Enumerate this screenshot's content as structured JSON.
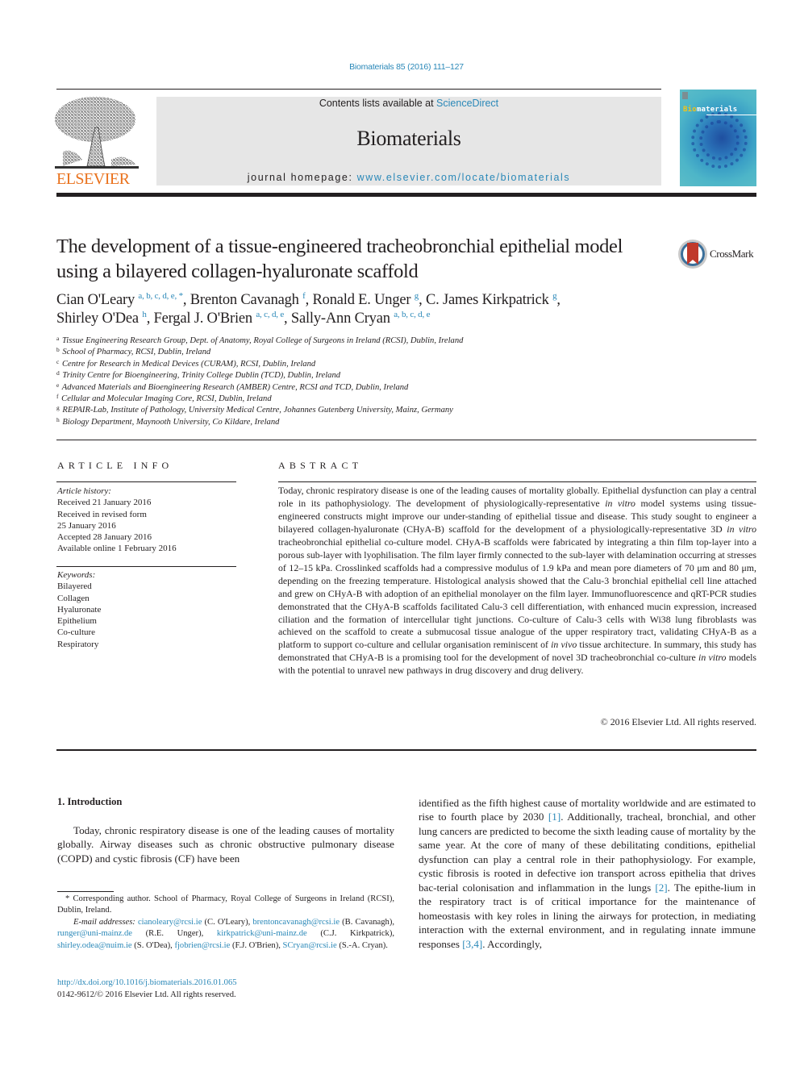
{
  "header": {
    "journal_ref": "Biomaterials 85 (2016) 111–127",
    "contents_prefix": "Contents lists available at ",
    "contents_link": "ScienceDirect",
    "journal_name": "Biomaterials",
    "homepage_prefix": "journal homepage: ",
    "homepage_link": "www.elsevier.com/locate/biomaterials",
    "publisher_logo_text": "ELSEVIER",
    "cover_title_highlight": "Bio",
    "cover_title_rest": "materials",
    "colors": {
      "link": "#2a88b8",
      "elsevier_orange": "#e9711c",
      "banner_gray": "#e6e6e6"
    }
  },
  "article": {
    "title": "The development of a tissue-engineered tracheobronchial epithelial model using a bilayered collagen-hyaluronate scaffold",
    "crossmark_label": "CrossMark",
    "authors": [
      {
        "name": "Cian O'Leary",
        "affil": "a, b, c, d, e, *",
        "sep": ", "
      },
      {
        "name": "Brenton Cavanagh",
        "affil": "f",
        "sep": ", "
      },
      {
        "name": "Ronald E. Unger",
        "affil": "g",
        "sep": ", "
      },
      {
        "name": "C. James Kirkpatrick",
        "affil": "g",
        "sep": ","
      },
      {
        "name": "Shirley O'Dea",
        "affil": "h",
        "sep": ", "
      },
      {
        "name": "Fergal J. O'Brien",
        "affil": "a, c, d, e",
        "sep": ", "
      },
      {
        "name": "Sally-Ann Cryan",
        "affil": "a, b, c, d, e",
        "sep": ""
      }
    ],
    "affiliations": [
      {
        "key": "a",
        "text": "Tissue Engineering Research Group, Dept. of Anatomy, Royal College of Surgeons in Ireland (RCSI), Dublin, Ireland"
      },
      {
        "key": "b",
        "text": "School of Pharmacy, RCSI, Dublin, Ireland"
      },
      {
        "key": "c",
        "text": "Centre for Research in Medical Devices (CURAM), RCSI, Dublin, Ireland"
      },
      {
        "key": "d",
        "text": "Trinity Centre for Bioengineering, Trinity College Dublin (TCD), Dublin, Ireland"
      },
      {
        "key": "e",
        "text": "Advanced Materials and Bioengineering Research (AMBER) Centre, RCSI and TCD, Dublin, Ireland"
      },
      {
        "key": "f",
        "text": "Cellular and Molecular Imaging Core, RCSI, Dublin, Ireland"
      },
      {
        "key": "g",
        "text": "REPAIR-Lab, Institute of Pathology, University Medical Centre, Johannes Gutenberg University, Mainz, Germany"
      },
      {
        "key": "h",
        "text": "Biology Department, Maynooth University, Co Kildare, Ireland"
      }
    ]
  },
  "article_info": {
    "heading": "ARTICLE INFO",
    "history_label": "Article history:",
    "history": [
      "Received 21 January 2016",
      "Received in revised form",
      "25 January 2016",
      "Accepted 28 January 2016",
      "Available online 1 February 2016"
    ],
    "keywords_label": "Keywords:",
    "keywords": [
      "Bilayered",
      "Collagen",
      "Hyaluronate",
      "Epithelium",
      "Co-culture",
      "Respiratory"
    ]
  },
  "abstract": {
    "heading": "ABSTRACT",
    "segments": [
      {
        "t": "Today, chronic respiratory disease is one of the leading causes of mortality globally. Epithelial dysfunction can play a central role in its pathophysiology. The development of physiologically-representative "
      },
      {
        "t": "in vitro",
        "i": true
      },
      {
        "t": " model systems using tissue-engineered constructs might improve our under-standing of epithelial tissue and disease. This study sought to engineer a bilayered collagen-hyaluronate (CHyA-B) scaffold for the development of a physiologically-representative 3D "
      },
      {
        "t": "in vitro",
        "i": true
      },
      {
        "t": " tracheobronchial epithelial co-culture model. CHyA-B scaffolds were fabricated by integrating a thin film top-layer into a porous sub-layer with lyophilisation. The film layer firmly connected to the sub-layer with delamination occurring at stresses of 12–15 kPa. Crosslinked scaffolds had a compressive modulus of 1.9 kPa and mean pore diameters of 70 μm and 80 μm, depending on the freezing temperature. Histological analysis showed that the Calu-3 bronchial epithelial cell line attached and grew on CHyA-B with adoption of an epithelial monolayer on the film layer. Immunofluorescence and qRT-PCR studies demonstrated that the CHyA-B scaffolds facilitated Calu-3 cell differentiation, with enhanced mucin expression, increased ciliation and the formation of intercellular tight junctions. Co-culture of Calu-3 cells with Wi38 lung fibroblasts was achieved on the scaffold to create a submucosal tissue analogue of the upper respiratory tract, validating CHyA-B as a platform to support co-culture and cellular organisation reminiscent of "
      },
      {
        "t": "in vivo",
        "i": true
      },
      {
        "t": " tissue architecture. In summary, this study has demonstrated that CHyA-B is a promising tool for the development of novel 3D tracheobronchial co-culture "
      },
      {
        "t": "in vitro",
        "i": true
      },
      {
        "t": " models with the potential to unravel new pathways in drug discovery and drug delivery."
      }
    ],
    "copyright": "© 2016 Elsevier Ltd. All rights reserved."
  },
  "body": {
    "intro_heading": "1.  Introduction",
    "left_paragraph": "Today, chronic respiratory disease is one of the leading causes of mortality globally. Airway diseases such as chronic obstructive pulmonary disease (COPD) and cystic fibrosis (CF) have been",
    "right_segments": [
      {
        "t": "identified as the fifth highest cause of mortality worldwide and are estimated to rise to fourth place by 2030 "
      },
      {
        "t": "[1]",
        "ref": true
      },
      {
        "t": ". Additionally, tracheal, bronchial, and other lung cancers are predicted to become the sixth leading cause of mortality by the same year. At the core of many of these debilitating conditions, epithelial dysfunction can play a central role in their pathophysiology. For example, cystic fibrosis is rooted in defective ion transport across epithelia that drives bac-terial colonisation and inflammation in the lungs "
      },
      {
        "t": "[2]",
        "ref": true
      },
      {
        "t": ". The epithe-lium in the respiratory tract is of critical importance for the maintenance of homeostasis with key roles in lining the airways for protection, in mediating interaction with the external environment, and in regulating innate immune responses "
      },
      {
        "t": "[3,4]",
        "ref": true
      },
      {
        "t": ". Accordingly,"
      }
    ]
  },
  "footnote": {
    "corresponding": "* Corresponding author. School of Pharmacy, Royal College of Surgeons in Ireland (RCSI), Dublin, Ireland.",
    "email_label": "E-mail addresses:",
    "emails": [
      {
        "email": "cianoleary@rcsi.ie",
        "who": " (C. O'Leary), "
      },
      {
        "email": "brentoncavanagh@rcsi.ie",
        "who": " (B. Cavanagh), "
      },
      {
        "email": "runger@uni-mainz.de",
        "who": " (R.E. Unger), "
      },
      {
        "email": "kirkpatrick@uni-mainz.de",
        "who": " (C.J. Kirkpatrick), "
      },
      {
        "email": "shirley.odea@nuim.ie",
        "who": " (S. O'Dea), "
      },
      {
        "email": "fjobrien@rcsi.ie",
        "who": " (F.J. O'Brien), "
      },
      {
        "email": "SCryan@rcsi.ie",
        "who": " (S.-A. Cryan)."
      }
    ],
    "doi": "http://dx.doi.org/10.1016/j.biomaterials.2016.01.065",
    "issn_line": "0142-9612/© 2016 Elsevier Ltd. All rights reserved."
  }
}
